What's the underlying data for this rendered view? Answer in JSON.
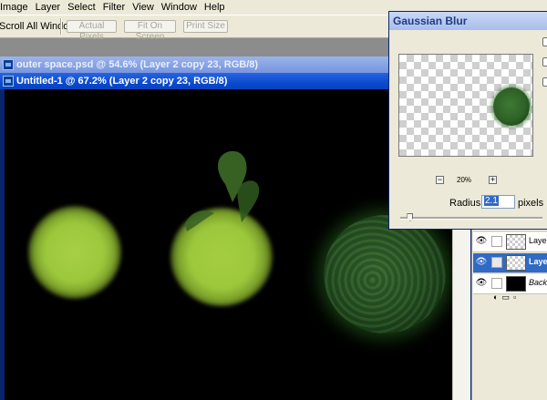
{
  "menubar": {
    "items": [
      "Image",
      "Layer",
      "Select",
      "Filter",
      "View",
      "Window",
      "Help"
    ]
  },
  "optionsbar": {
    "scroll_all_windows": "Scroll All Windows",
    "actual_pixels": "Actual Pixels",
    "fit_on_screen": "Fit On Screen",
    "print_size": "Print Size"
  },
  "windows": {
    "outer_space_title": "outer space.psd @ 54.6% (Layer 2 copy 23, RGB/8)",
    "untitled_title": "Untitled-1 @ 67.2% (Layer 2 copy 23, RGB/8)"
  },
  "gaussian_blur": {
    "title": "Gaussian Blur",
    "zoom_minus": "−",
    "zoom_plus": "+",
    "zoom": "20%",
    "radius_label": "Radius:",
    "radius_value": "2.1",
    "radius_unit": "pixels",
    "slider_fraction": 0.07
  },
  "layers_panel": {
    "rows": [
      {
        "label": "Layer",
        "selected": false
      },
      {
        "label": "Layer",
        "selected": true
      },
      {
        "label": "Background",
        "selected": false
      }
    ]
  },
  "colors": {
    "canvas_bg": "#000000",
    "orb_green": "#9cc83c",
    "title_active": "#0a4bcf",
    "selection": "#316ac5"
  }
}
